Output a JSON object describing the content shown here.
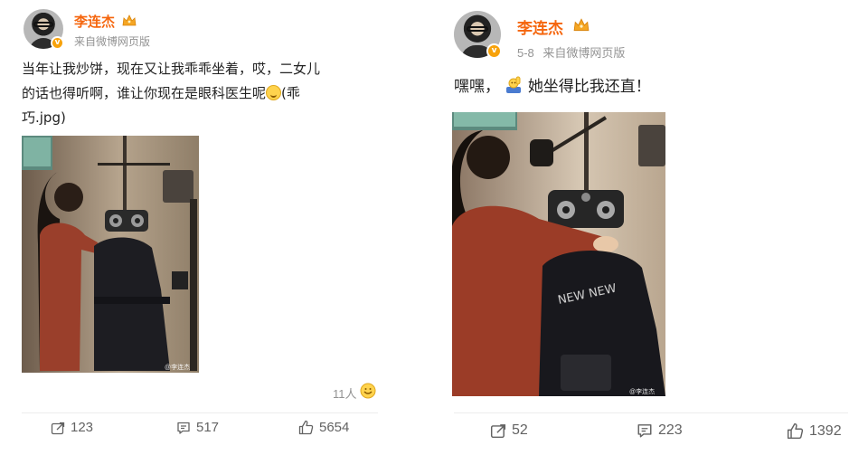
{
  "left_post": {
    "username": "李连杰",
    "source": "来自微博网页版",
    "date": "",
    "text_line1": "当年让我炒饼，现在又让我乖乖坐着，哎，二女儿",
    "text_line2": "的话也得听啊，谁让你现在是眼科医生呢",
    "text_line2_tail": "(乖",
    "text_line3": "巧.jpg)",
    "photo_watermark": "@李连杰",
    "like_people": "11人",
    "actions": {
      "repost": "123",
      "comment": "517",
      "like": "5654"
    },
    "icons": {
      "badge": "verified-v-icon",
      "crown": "crown-icon",
      "emoji": "smile-emoji-icon"
    }
  },
  "right_post": {
    "username": "李连杰",
    "date": "5-8",
    "source": "来自微博网页版",
    "text": "嘿嘿，",
    "text_tail": "她坐得比我还直！",
    "photo_watermark": "@李连杰",
    "actions": {
      "repost": "52",
      "comment": "223",
      "like": "1392"
    },
    "icons": {
      "badge": "verified-v-icon",
      "crown": "crown-icon",
      "emoji": "raised-hand-emoji-icon"
    }
  },
  "colors": {
    "username": "#f5660e",
    "meta": "#939393",
    "badge": "#f7a20b",
    "action_text": "#636363"
  }
}
